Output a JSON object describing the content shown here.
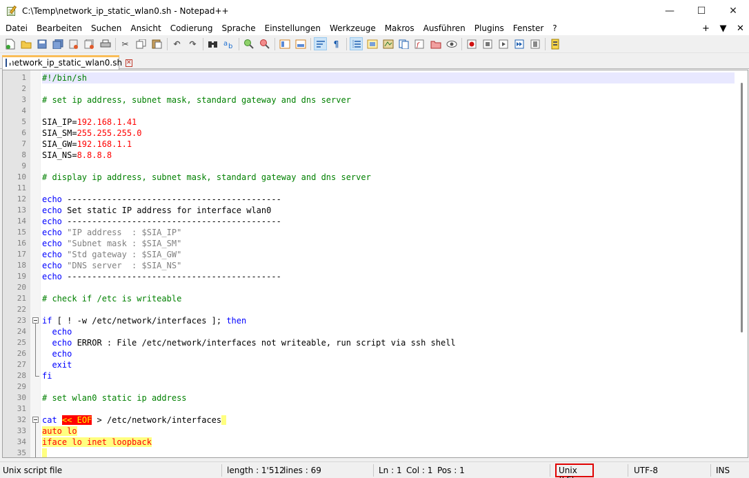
{
  "window": {
    "title": "C:\\Temp\\network_ip_static_wlan0.sh - Notepad++",
    "controls": {
      "minimize": "—",
      "maximize": "☐",
      "close": "✕"
    }
  },
  "menu": {
    "items": [
      "Datei",
      "Bearbeiten",
      "Suchen",
      "Ansicht",
      "Codierung",
      "Sprache",
      "Einstellungen",
      "Werkzeuge",
      "Makros",
      "Ausführen",
      "Plugins",
      "Fenster",
      "?"
    ],
    "right": [
      "+",
      "▼",
      "✕"
    ]
  },
  "toolbar": {
    "icons": [
      "new-file-icon",
      "open-file-icon",
      "save-icon",
      "save-all-icon",
      "close-icon",
      "close-all-icon",
      "print-icon",
      "cut-icon",
      "copy-icon",
      "paste-icon",
      "undo-icon",
      "redo-icon",
      "find-icon",
      "replace-icon",
      "zoom-in-icon",
      "zoom-out-icon",
      "sync-vertical-icon",
      "sync-horizontal-icon",
      "word-wrap-icon",
      "show-all-chars-icon",
      "indent-guide-icon",
      "udl-icon",
      "doc-map-icon",
      "doc-list-icon",
      "function-list-icon",
      "folder-workspace-icon",
      "monitoring-icon",
      "record-macro-icon",
      "stop-record-icon",
      "play-macro-icon",
      "run-macro-multiple-icon",
      "save-macro-icon",
      "spell-check-icon"
    ]
  },
  "tab": {
    "label": "network_ip_static_wlan0.sh"
  },
  "editor": {
    "lines": [
      {
        "n": "1",
        "segs": [
          {
            "t": "#!/bin/sh",
            "c": "c-comment"
          }
        ]
      },
      {
        "n": "2",
        "segs": []
      },
      {
        "n": "3",
        "segs": [
          {
            "t": "# set ip address, subnet mask, standard gateway and dns server",
            "c": "c-comment"
          }
        ]
      },
      {
        "n": "4",
        "segs": []
      },
      {
        "n": "5",
        "segs": [
          {
            "t": "SIA_IP=",
            "c": "c-plain"
          },
          {
            "t": "192.168.1.41",
            "c": "c-num"
          }
        ]
      },
      {
        "n": "6",
        "segs": [
          {
            "t": "SIA_SM=",
            "c": "c-plain"
          },
          {
            "t": "255.255.255.0",
            "c": "c-num"
          }
        ]
      },
      {
        "n": "7",
        "segs": [
          {
            "t": "SIA_GW=",
            "c": "c-plain"
          },
          {
            "t": "192.168.1.1",
            "c": "c-num"
          }
        ]
      },
      {
        "n": "8",
        "segs": [
          {
            "t": "SIA_NS=",
            "c": "c-plain"
          },
          {
            "t": "8.8.8.8",
            "c": "c-num"
          }
        ]
      },
      {
        "n": "9",
        "segs": []
      },
      {
        "n": "10",
        "segs": [
          {
            "t": "# display ip address, subnet mask, standard gateway and dns server",
            "c": "c-comment"
          }
        ]
      },
      {
        "n": "11",
        "segs": []
      },
      {
        "n": "12",
        "segs": [
          {
            "t": "echo",
            "c": "c-kw"
          },
          {
            "t": " -------------------------------------------",
            "c": "c-plain"
          }
        ]
      },
      {
        "n": "13",
        "segs": [
          {
            "t": "echo",
            "c": "c-kw"
          },
          {
            "t": " Set static IP address for interface wlan0",
            "c": "c-plain"
          }
        ]
      },
      {
        "n": "14",
        "segs": [
          {
            "t": "echo",
            "c": "c-kw"
          },
          {
            "t": " -------------------------------------------",
            "c": "c-plain"
          }
        ]
      },
      {
        "n": "15",
        "segs": [
          {
            "t": "echo",
            "c": "c-kw"
          },
          {
            "t": " ",
            "c": "c-plain"
          },
          {
            "t": "\"IP address  : $SIA_IP\"",
            "c": "c-str"
          }
        ]
      },
      {
        "n": "16",
        "segs": [
          {
            "t": "echo",
            "c": "c-kw"
          },
          {
            "t": " ",
            "c": "c-plain"
          },
          {
            "t": "\"Subnet mask : $SIA_SM\"",
            "c": "c-str"
          }
        ]
      },
      {
        "n": "17",
        "segs": [
          {
            "t": "echo",
            "c": "c-kw"
          },
          {
            "t": " ",
            "c": "c-plain"
          },
          {
            "t": "\"Std gateway : $SIA_GW\"",
            "c": "c-str"
          }
        ]
      },
      {
        "n": "18",
        "segs": [
          {
            "t": "echo",
            "c": "c-kw"
          },
          {
            "t": " ",
            "c": "c-plain"
          },
          {
            "t": "\"DNS server  : $SIA_NS\"",
            "c": "c-str"
          }
        ]
      },
      {
        "n": "19",
        "segs": [
          {
            "t": "echo",
            "c": "c-kw"
          },
          {
            "t": " -------------------------------------------",
            "c": "c-plain"
          }
        ]
      },
      {
        "n": "20",
        "segs": []
      },
      {
        "n": "21",
        "segs": [
          {
            "t": "# check if /etc is writeable",
            "c": "c-comment"
          }
        ]
      },
      {
        "n": "22",
        "segs": []
      },
      {
        "n": "23",
        "fold": "open",
        "segs": [
          {
            "t": "if",
            "c": "c-kw"
          },
          {
            "t": " [ ! -w /etc/network/interfaces ]; ",
            "c": "c-plain"
          },
          {
            "t": "then",
            "c": "c-kw"
          }
        ]
      },
      {
        "n": "24",
        "fold": "line",
        "segs": [
          {
            "t": "  ",
            "c": "c-plain"
          },
          {
            "t": "echo",
            "c": "c-kw"
          }
        ]
      },
      {
        "n": "25",
        "fold": "line",
        "segs": [
          {
            "t": "  ",
            "c": "c-plain"
          },
          {
            "t": "echo",
            "c": "c-kw"
          },
          {
            "t": " ERROR : File /etc/network/interfaces not writeable, run script via ssh shell",
            "c": "c-plain"
          }
        ]
      },
      {
        "n": "26",
        "fold": "line",
        "segs": [
          {
            "t": "  ",
            "c": "c-plain"
          },
          {
            "t": "echo",
            "c": "c-kw"
          }
        ]
      },
      {
        "n": "27",
        "fold": "line",
        "segs": [
          {
            "t": "  ",
            "c": "c-plain"
          },
          {
            "t": "exit",
            "c": "c-kw"
          }
        ]
      },
      {
        "n": "28",
        "fold": "end",
        "segs": [
          {
            "t": "fi",
            "c": "c-kw"
          }
        ]
      },
      {
        "n": "29",
        "segs": []
      },
      {
        "n": "30",
        "segs": [
          {
            "t": "# set wlan0 static ip address",
            "c": "c-comment"
          }
        ]
      },
      {
        "n": "31",
        "segs": []
      },
      {
        "n": "32",
        "fold": "open",
        "segs": [
          {
            "t": "cat",
            "c": "c-kw"
          },
          {
            "t": " ",
            "c": "c-plain"
          },
          {
            "t": "<< EOF",
            "c": "c-heredelim"
          },
          {
            "t": " > /etc/network/interfaces",
            "c": "c-plain"
          },
          {
            "t": " ",
            "c": "here-bg"
          }
        ]
      },
      {
        "n": "33",
        "fold": "line",
        "segs": [
          {
            "t": "auto lo",
            "c": "c-here"
          }
        ]
      },
      {
        "n": "34",
        "fold": "line",
        "segs": [
          {
            "t": "iface lo inet loopback",
            "c": "c-here"
          }
        ]
      },
      {
        "n": "35",
        "fold": "line",
        "segs": [
          {
            "t": " ",
            "c": "c-here"
          }
        ]
      }
    ]
  },
  "status": {
    "file_type": "Unix script file",
    "length": "length : 1'512",
    "lines": "lines : 69",
    "ln": "Ln : 1",
    "col": "Col : 1",
    "pos": "Pos : 1",
    "eol": "Unix (LF)",
    "encoding": "UTF-8",
    "mode": "INS"
  }
}
